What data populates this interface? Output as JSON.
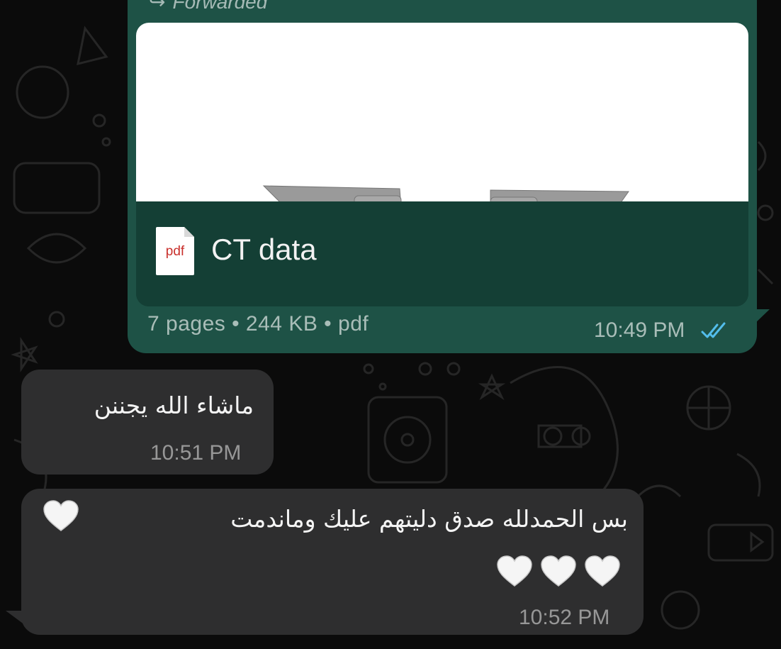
{
  "chat": {
    "outgoing_document": {
      "forwarded_label": "Forwarded",
      "forward_icon": "forward-arrow-icon",
      "file_type_icon_label": "pdf",
      "file_name": "CT data",
      "meta": "7 pages • 244 KB • pdf",
      "time": "10:49 PM",
      "status_icon": "double-check-read-icon",
      "status_color": "#53bdeb"
    },
    "incoming": [
      {
        "text": "ماشاء الله يجننن",
        "time": "10:51 PM"
      },
      {
        "text_line1": "بس الحمدلله صدق دليتهم عليك وماندمت",
        "time": "10:52 PM",
        "emoji": "white-heart-icon"
      }
    ]
  },
  "colors": {
    "outgoing_bubble": "#1e5246",
    "incoming_bubble": "#2e2e2f",
    "background": "#0b0b0b"
  }
}
